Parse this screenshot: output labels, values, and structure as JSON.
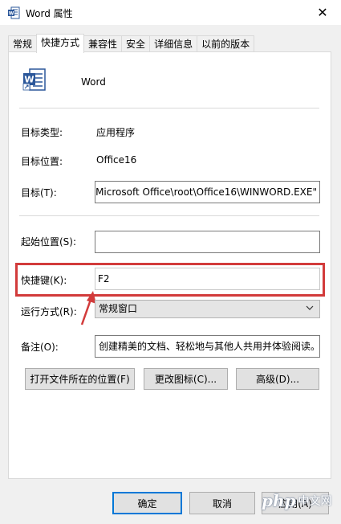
{
  "window": {
    "title": "Word 属性",
    "close_glyph": "✕"
  },
  "tabs": [
    {
      "label": "常规"
    },
    {
      "label": "快捷方式"
    },
    {
      "label": "兼容性"
    },
    {
      "label": "安全"
    },
    {
      "label": "详细信息"
    },
    {
      "label": "以前的版本"
    }
  ],
  "active_tab": "快捷方式",
  "shortcut": {
    "app_name": "Word",
    "target_type_label": "目标类型:",
    "target_type_value": "应用程序",
    "target_location_label": "目标位置:",
    "target_location_value": "Office16",
    "target_label": "目标(T):",
    "target_value": "\\Microsoft Office\\root\\Office16\\WINWORD.EXE\"",
    "start_in_label": "起始位置(S):",
    "start_in_value": "",
    "hotkey_label": "快捷键(K):",
    "hotkey_value": "F2",
    "run_label": "运行方式(R):",
    "run_value": "常规窗口",
    "comment_label": "备注(O):",
    "comment_value": "创建精美的文档、轻松地与其他人共用并体验阅读。"
  },
  "panel_buttons": {
    "open_location": "打开文件所在的位置(F)",
    "change_icon": "更改图标(C)...",
    "advanced": "高级(D)..."
  },
  "dialog_buttons": {
    "ok": "确定",
    "cancel": "取消",
    "apply": "应用(A)"
  },
  "watermark": {
    "logo": "php",
    "text": "中文网"
  },
  "colors": {
    "word_blue": "#2b579a",
    "highlight_red": "#d23b3b"
  }
}
